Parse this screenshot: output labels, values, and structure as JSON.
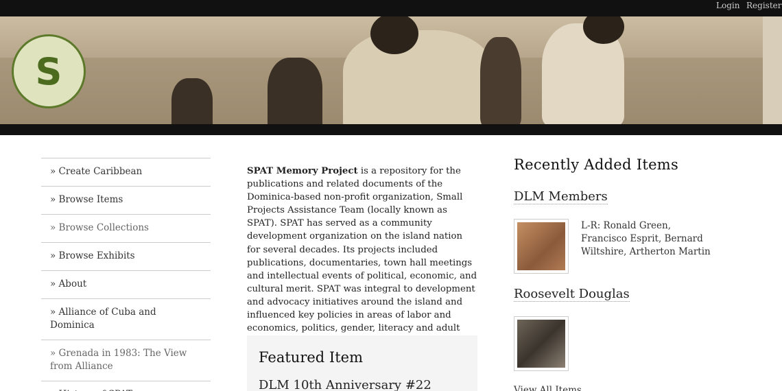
{
  "top_nav": {
    "login": "Login",
    "register": "Register"
  },
  "logo": {
    "text": "S"
  },
  "sidebar": {
    "items": [
      {
        "label": "» Create Caribbean"
      },
      {
        "label": "» Browse Items"
      },
      {
        "label": "» Browse Collections"
      },
      {
        "label": "» Browse Exhibits"
      },
      {
        "label": "» About"
      },
      {
        "label": "» Alliance of Cuba and Dominica"
      },
      {
        "label": "» Grenada in 1983: The View from Alliance"
      },
      {
        "label": "» History of SPAT"
      }
    ]
  },
  "main": {
    "intro_bold": "SPAT Memory Project",
    "intro_text": " is a repository for the publications and related documents of the Dominica-based non-profit organization, Small Projects Assistance Team (locally known as SPAT). SPAT has served as a community development organization on the island nation for several decades. Its projects included publications, documentaries, town hall meetings and intellectual events of political, economic, and cultural merit. SPAT was integral to development and advocacy initiatives around the island and influenced key policies in areas of labor and economics, politics, gender, literacy and adult education, creative and performing arts, indigenous culture."
  },
  "featured": {
    "heading": "Featured Item",
    "title": "DLM 10th Anniversary #22"
  },
  "recent": {
    "heading": "Recently Added Items",
    "items": [
      {
        "title": "DLM Members",
        "caption": "L-R: Ronald Green, Francisco Esprit, Bernard Wiltshire, Artherton Martin"
      },
      {
        "title": "Roosevelt Douglas",
        "caption": ""
      }
    ],
    "view_all": "View All Items"
  }
}
